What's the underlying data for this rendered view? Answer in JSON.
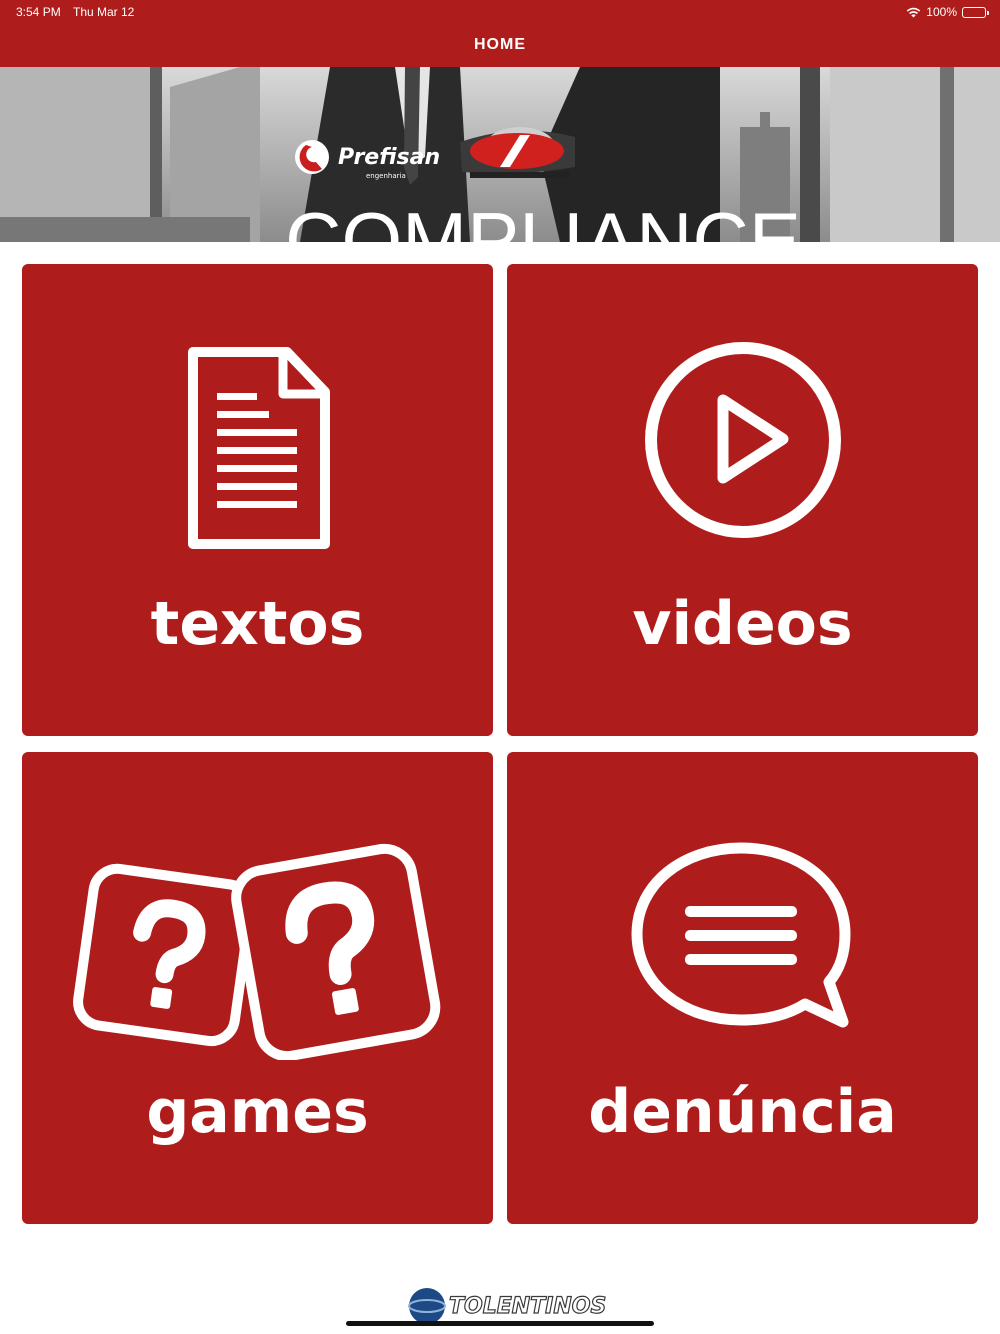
{
  "status_bar": {
    "time": "3:54 PM",
    "date": "Thu Mar 12",
    "battery": "100%"
  },
  "nav": {
    "title": "HOME"
  },
  "banner": {
    "brand_1": "Prefisan",
    "brand_1_sub": "engenharia",
    "headline": "COMPLIANCE"
  },
  "tiles": [
    {
      "label": "textos",
      "icon": "document-icon"
    },
    {
      "label": "videos",
      "icon": "play-circle-icon"
    },
    {
      "label": "games",
      "icon": "question-dice-icon"
    },
    {
      "label": "denúncia",
      "icon": "chat-bubble-icon"
    }
  ],
  "footer": {
    "logo_text": "TOLENTINOS"
  },
  "colors": {
    "primary": "#ae1d1b",
    "background": "#ffffff",
    "text_on_primary": "#ffffff"
  }
}
